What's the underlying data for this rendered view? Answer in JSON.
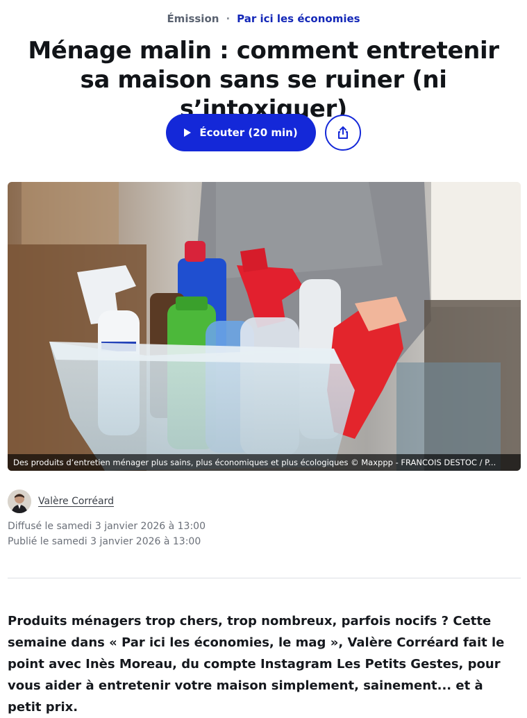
{
  "breadcrumb": {
    "type": "Émission",
    "separator": "·",
    "show": "Par ici les économies"
  },
  "article": {
    "title": "Ménage malin : comment entretenir sa maison sans se ruiner (ni s’intoxiquer)",
    "listen_label": "Écouter (20 min)",
    "image_caption": "Des produits d’entretien ménager plus sains, plus économiques et plus écologiques © Maxppp - FRANCOIS DESTOC / P...",
    "author": "Valère Corréard",
    "broadcast": "Diffusé le samedi 3 janvier 2026 à 13:00",
    "published": "Publié le samedi 3 janvier 2026 à 13:00",
    "lead": "Produits ménagers trop chers, trop nombreux, parfois nocifs ? Cette semaine dans « Par ici les économies, le mag », Valère Corréard fait le point avec Inès Moreau, du compte Instagram Les Petits Gestes, pour vous aider à entretenir votre maison simplement, sainement... et à petit prix."
  },
  "icons": {
    "play": "play-icon",
    "share": "share-icon"
  },
  "colors": {
    "accent": "#1428d8",
    "show_link": "#1428b8",
    "text": "#111418",
    "muted": "#6a6f78"
  }
}
